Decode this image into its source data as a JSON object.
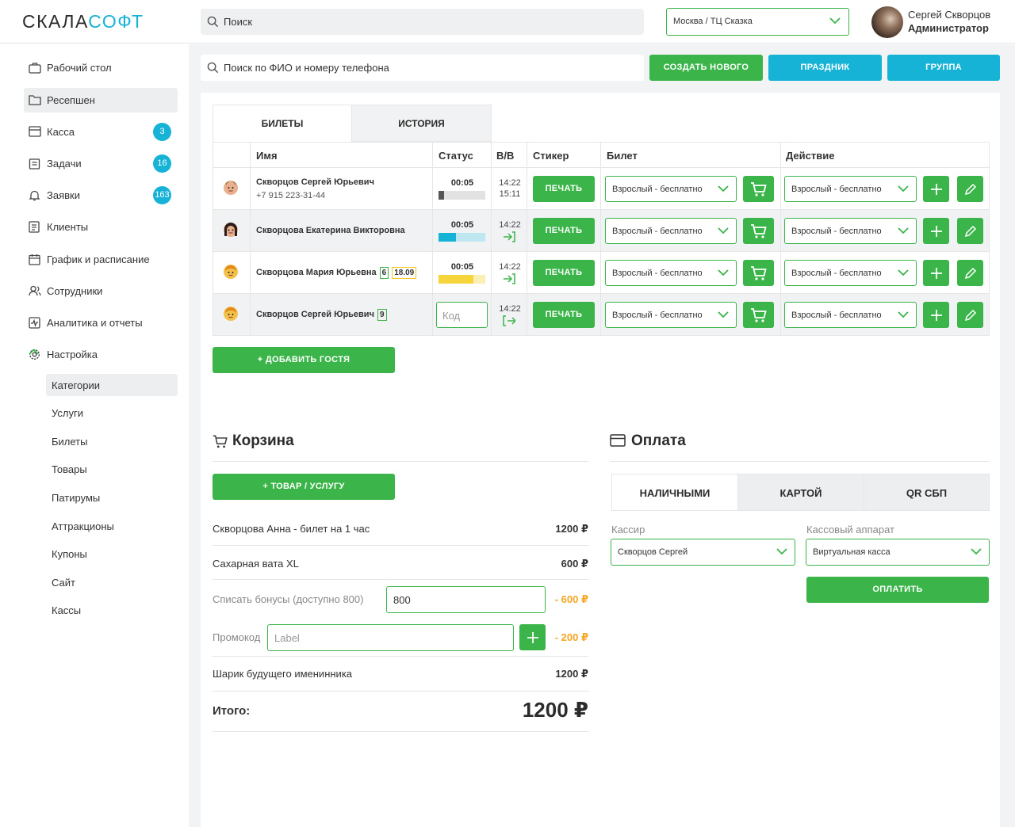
{
  "header": {
    "logo_part1": "СКАЛА",
    "logo_part2": "СОФТ",
    "search_placeholder": "Поиск",
    "location": "Москва / ТЦ Сказка",
    "user_name": "Сергей Скворцов",
    "user_role": "Администратор"
  },
  "sidebar": {
    "items": [
      {
        "label": "Рабочий стол",
        "icon": "briefcase-icon"
      },
      {
        "label": "Ресепшен",
        "icon": "folder-icon"
      },
      {
        "label": "Касса",
        "icon": "wallet-icon",
        "badge": "3"
      },
      {
        "label": "Задачи",
        "icon": "clipboard-icon",
        "badge": "16"
      },
      {
        "label": "Заявки",
        "icon": "bell-icon",
        "badge": "163"
      },
      {
        "label": "Клиенты",
        "icon": "contacts-icon"
      },
      {
        "label": "График и расписание",
        "icon": "calendar-icon"
      },
      {
        "label": "Сотрудники",
        "icon": "users-icon"
      },
      {
        "label": "Аналитика и отчеты",
        "icon": "analytics-icon"
      },
      {
        "label": "Настройка",
        "icon": "gear-icon"
      }
    ],
    "sub_items": [
      "Категории",
      "Услуги",
      "Билеты",
      "Товары",
      "Патирумы",
      "Аттракционы",
      "Купоны",
      "Сайт",
      "Кассы"
    ]
  },
  "content": {
    "search_placeholder": "Поиск по ФИО и номеру телефона",
    "btn_create": "СОЗДАТЬ НОВОГО",
    "btn_holiday": "ПРАЗДНИК",
    "btn_group": "ГРУППА"
  },
  "tabs": [
    "БИЛЕТЫ",
    "ИСТОРИЯ"
  ],
  "table": {
    "headers": [
      "Имя",
      "Статус",
      "В/В",
      "Стикер",
      "Билет",
      "Действие"
    ],
    "print_label": "ПЕЧАТЬ",
    "code_placeholder": "Код",
    "rows": [
      {
        "name": "Скворцов Сергей Юрьевич",
        "phone": "+7 915 223-31-44",
        "timer": "00:05",
        "progress": 0.12,
        "progress_color": "#555555",
        "time_in": "14:22",
        "time_out": "15:11",
        "ticket": "Взрослый - бесплатно",
        "action": "Взрослый - бесплатно"
      },
      {
        "name": "Скворцова Екатерина Викторовна",
        "timer": "00:05",
        "progress": 0.38,
        "progress_color": "#16b3d6",
        "time_in": "14:22",
        "ticket": "Взрослый - бесплатно",
        "action": "Взрослый - бесплатно"
      },
      {
        "name": "Скворцова Мария Юрьевна",
        "tag1": "6",
        "tag2": "18.09",
        "timer": "00:05",
        "progress": 0.75,
        "progress_color": "#f5d53a",
        "time_in": "14:22",
        "ticket": "Взрослый - бесплатно",
        "action": "Взрослый - бесплатно"
      },
      {
        "name": "Скворцов Сергей Юрьевич",
        "tag1": "9",
        "time_in": "14:22",
        "ticket": "Взрослый - бесплатно",
        "action": "Взрослый - бесплатно"
      }
    ]
  },
  "add_guest": "+ ДОБАВИТЬ ГОСТЯ",
  "cart": {
    "title": "Корзина",
    "add_item": "+ ТОВАР / УСЛУГУ",
    "item1_name": "Скворцова Анна - билет на 1 час",
    "item1_price": "1200 ₽",
    "item2_name": "Сахарная вата XL",
    "item2_price": "600 ₽",
    "bonus_label": "Списать бонусы (доступно 800)",
    "bonus_value": "800",
    "bonus_discount": "- 600 ₽",
    "promo_label": "Промокод",
    "promo_placeholder": "Label",
    "promo_discount": "- 200 ₽",
    "item3_name": "Шарик будущего именинника",
    "item3_price": "1200 ₽",
    "total_label": "Итого:",
    "total_value": "1200 ₽"
  },
  "payment": {
    "title": "Оплата",
    "tabs": [
      "НАЛИЧНЫМИ",
      "КАРТОЙ",
      "QR СБП"
    ],
    "cashier_label": "Кассир",
    "cashier_value": "Скворцов Сергей",
    "register_label": "Кассовый аппарат",
    "register_value": "Виртуальная касса",
    "pay_button": "ОПЛАТИТЬ"
  },
  "colors": {
    "green": "#3bb54a",
    "blue": "#16b3d6",
    "orange": "#f5a623"
  }
}
